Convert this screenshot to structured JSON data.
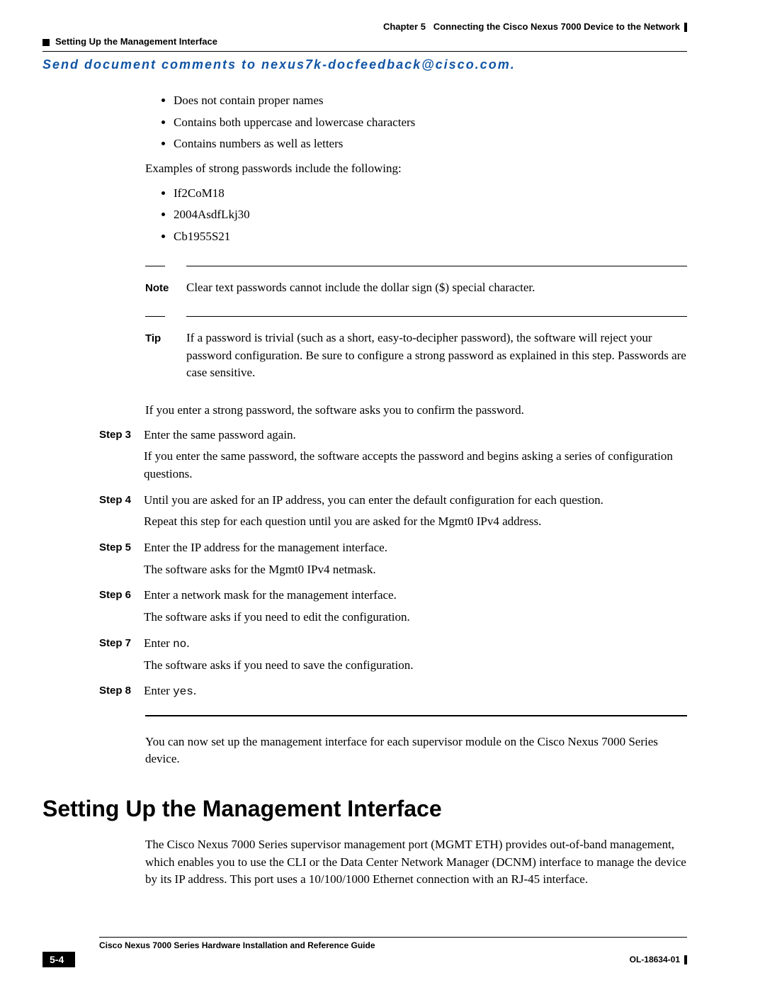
{
  "header": {
    "chapter_label": "Chapter 5",
    "chapter_title": "Connecting the Cisco Nexus 7000 Device to the Network",
    "section_crumb": "Setting Up the Management Interface"
  },
  "feedback_line": "Send document comments to nexus7k-docfeedback@cisco.com.",
  "intro_bullets": [
    "Does not contain proper names",
    "Contains both uppercase and lowercase characters",
    "Contains numbers as well as letters"
  ],
  "examples_lead": "Examples of strong passwords include the following:",
  "example_bullets": [
    "If2CoM18",
    "2004AsdfLkj30",
    "Cb1955S21"
  ],
  "note": {
    "label": "Note",
    "text": "Clear text passwords cannot include the dollar sign ($) special character."
  },
  "tip": {
    "label": "Tip",
    "text": "If a password is trivial (such as a short, easy-to-decipher password), the software will reject your password configuration. Be sure to configure a strong password as explained in this step. Passwords are case sensitive."
  },
  "confirm_line": "If you enter a strong password, the software asks you to confirm the password.",
  "steps": {
    "s3": {
      "label": "Step 3",
      "l1": "Enter the same password again.",
      "l2": "If you enter the same password, the software accepts the password and begins asking a series of configuration questions."
    },
    "s4": {
      "label": "Step 4",
      "l1": "Until you are asked for an IP address, you can enter the default configuration for each question.",
      "l2": "Repeat this step for each question until you are asked for the Mgmt0 IPv4 address."
    },
    "s5": {
      "label": "Step 5",
      "l1": "Enter the IP address for the management interface.",
      "l2": "The software asks for the Mgmt0 IPv4 netmask."
    },
    "s6": {
      "label": "Step 6",
      "l1": "Enter a network mask for the management interface.",
      "l2": "The software asks if you need to edit the configuration."
    },
    "s7": {
      "label": "Step 7",
      "l1a": "Enter ",
      "l1b": "no",
      "l1c": ".",
      "l2": "The software asks if you need to save the configuration."
    },
    "s8": {
      "label": "Step 8",
      "l1a": "Enter ",
      "l1b": "yes",
      "l1c": "."
    }
  },
  "closing": "You can now set up the management interface for each supervisor module on the Cisco Nexus 7000 Series device.",
  "h1": "Setting Up the Management Interface",
  "section_para": "The Cisco Nexus 7000 Series supervisor management port (MGMT ETH) provides out-of-band management, which enables you to use the CLI or the Data Center Network Manager (DCNM) interface to manage the device by its IP address. This port uses a 10/100/1000 Ethernet connection with an RJ-45 interface.",
  "footer": {
    "guide_title": "Cisco Nexus 7000 Series Hardware Installation and Reference Guide",
    "page_num": "5-4",
    "doc_id": "OL-18634-01"
  }
}
